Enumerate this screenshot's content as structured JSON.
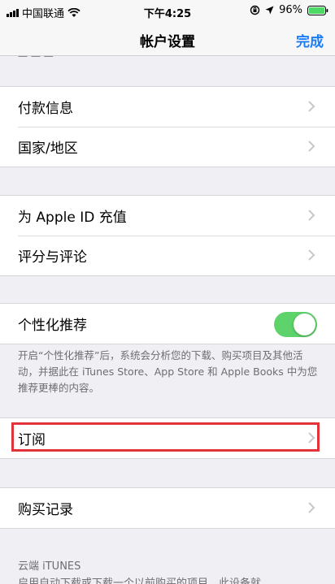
{
  "status_bar": {
    "carrier": "中国联通",
    "time": "下午4:25",
    "battery_percent": "96%"
  },
  "nav": {
    "title": "帐户设置",
    "done_label": "完成"
  },
  "scroll_remnant": "一 一 一",
  "group1": {
    "items": [
      {
        "label": "付款信息"
      },
      {
        "label": "国家/地区"
      }
    ]
  },
  "group2": {
    "items": [
      {
        "label": "为 Apple ID 充值"
      },
      {
        "label": "评分与评论"
      }
    ]
  },
  "group3": {
    "personalized_label": "个性化推荐",
    "personalized_enabled": true,
    "footer": "开启“个性化推荐”后，系统会分析您的下载、购买项目及其他活动，并据此在 iTunes Store、App Store 和 Apple Books 中为您推荐更棒的内容。"
  },
  "group4": {
    "subscriptions_label": "订阅"
  },
  "group5": {
    "purchase_history_label": "购买记录"
  },
  "itunes_cloud": {
    "header": "云端 iTUNES",
    "partial_text": "启用自动下载或下载一个以前购买的项目，此设备就"
  },
  "colors": {
    "accent": "#1a7cf7",
    "toggle_on": "#5fd36b",
    "highlight": "#e0333a",
    "background": "#efeff4"
  }
}
